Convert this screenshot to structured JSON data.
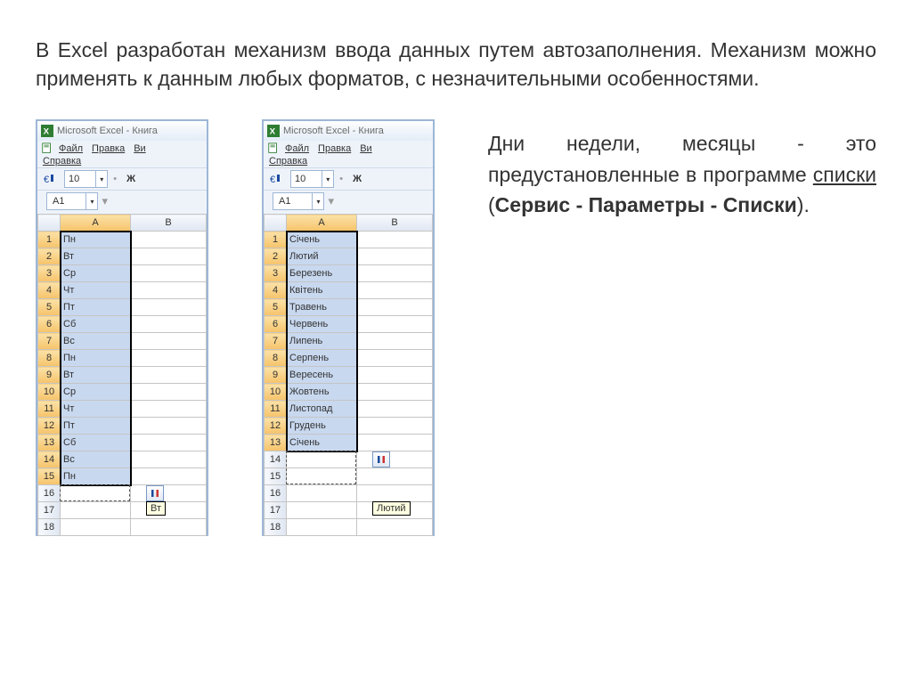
{
  "paragraph1": "В Excel разработан механизм ввода данных путем автозаполнения. Механизм можно применять к данным любых форматов, с незначительными особенностями.",
  "right_text": {
    "part1": "Дни недели, месяцы - это предустановленные в программе ",
    "underline": "списки",
    "part2": " (",
    "bold": "Сервис - Параметры - Списки",
    "part3": ")."
  },
  "window": {
    "title": "Microsoft Excel - Книга",
    "menu_file": "Файл",
    "menu_edit": "Правка",
    "menu_view": "Ви",
    "menu_help": "Справка",
    "font_size": "10",
    "bold_btn": "Ж",
    "name_box": "A1",
    "col_a": "A",
    "col_b": "B"
  },
  "left_table": {
    "rows": [
      "Пн",
      "Вт",
      "Ср",
      "Чт",
      "Пт",
      "Сб",
      "Вс",
      "Пн",
      "Вт",
      "Ср",
      "Чт",
      "Пт",
      "Сб",
      "Вс",
      "Пн"
    ],
    "blank_rows": [
      16,
      17,
      18
    ],
    "selected_count": 15,
    "fill_row": 16,
    "tooltip": "Вт",
    "tooltip_row": 17,
    "icon_row": 16
  },
  "right_table": {
    "rows": [
      "Січень",
      "Лютий",
      "Березень",
      "Квітень",
      "Травень",
      "Червень",
      "Липень",
      "Серпень",
      "Вересень",
      "Жовтень",
      "Листопад",
      "Грудень",
      "Січень"
    ],
    "blank_rows": [
      14,
      15,
      16,
      17,
      18
    ],
    "selected_count": 13,
    "fill_extra": [
      14,
      15
    ],
    "tooltip": "Лютий",
    "tooltip_row": 17,
    "icon_row": 14
  }
}
